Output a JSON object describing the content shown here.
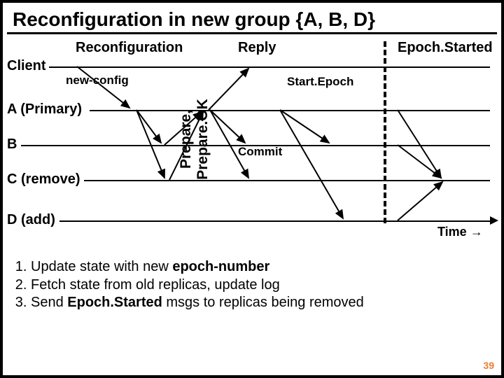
{
  "title": "Reconfiguration in new group {A, B, D}",
  "phases": {
    "reconfig": "Reconfiguration",
    "reply": "Reply",
    "epochStarted": "Epoch.Started"
  },
  "lanes": {
    "client": "Client",
    "a": "A (Primary)",
    "b": "B",
    "c": "C (remove)",
    "d": "D (add)"
  },
  "msgs": {
    "newConfig": "new-config",
    "prepare": "Prepare,\nPrepare.OK",
    "commit": "Commit",
    "startEpoch": "Start.Epoch"
  },
  "time": "Time →",
  "steps": {
    "s1_a": "Update state with new ",
    "s1_b": "epoch-number",
    "s2": "Fetch state from old replicas, update log",
    "s3_a": "Send ",
    "s3_b": "Epoch.Started",
    "s3_c": " msgs to replicas being removed"
  },
  "page": "39"
}
